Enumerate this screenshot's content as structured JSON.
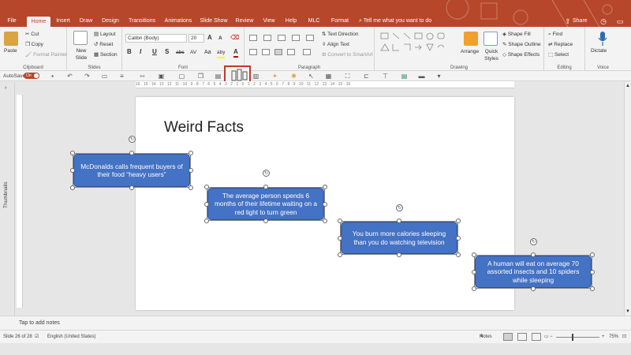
{
  "tabs": [
    "File",
    "Home",
    "Insert",
    "Draw",
    "Design",
    "Transitions",
    "Animations",
    "Slide Show",
    "Review",
    "View",
    "Help",
    "MLC",
    "Format"
  ],
  "tell_me": "Tell me what you want to do",
  "share": "Share",
  "ribbon": {
    "clipboard": {
      "label": "Clipboard",
      "paste": "Paste",
      "cut": "Cut",
      "copy": "Copy",
      "format_painter": "Format Painter"
    },
    "slides": {
      "label": "Slides",
      "new_slide": "New Slide",
      "layout": "Layout",
      "reset": "Reset",
      "section": "Section"
    },
    "font": {
      "label": "Font",
      "name": "Calibri (Body)",
      "size": "20",
      "bold": "B",
      "italic": "I",
      "underline": "U",
      "strike": "S",
      "abc": "abc",
      "spacing": "AV",
      "case": "Aa",
      "grow": "A",
      "shrink": "A",
      "highlight": "aby",
      "color": "A"
    },
    "paragraph": {
      "label": "Paragraph",
      "text_direction": "Text Direction",
      "align_text": "Align Text",
      "smartart": "Convert to SmartArt"
    },
    "drawing": {
      "label": "Drawing",
      "arrange": "Arrange",
      "quick_styles": "Quick Styles",
      "shape_fill": "Shape Fill",
      "shape_outline": "Shape Outline",
      "shape_effects": "Shape Effects"
    },
    "editing": {
      "label": "Editing",
      "find": "Find",
      "replace": "Replace",
      "select": "Select"
    },
    "voice": {
      "label": "Voice",
      "dictate": "Dictate"
    }
  },
  "qat": {
    "autosave": "AutoSave",
    "toggle": "On"
  },
  "ruler_text": "16 · 15 · 14 · 13 · 12 · 11 · 10 · 9 · 8 · 7 · 6 · 5 · 4 · 3 · 2 · 1 · 0 · 1 · 2 · 3 · 4 · 5 · 6 · 7 · 8 · 9 · 10 · 11 · 12 · 13 · 14 · 15 · 16",
  "thumbnails_label": "Thumbnails",
  "slide": {
    "title": "Weird Facts",
    "boxes": [
      "McDonalds calls frequent buyers of their food “heavy users”",
      "The average person spends 6 months of their lifetime waiting on a red light to turn green",
      "You burn more calories sleeping than you do watching television",
      "A human will eat on average 70 assorted insects and 10 spiders while sleeping"
    ]
  },
  "notes_placeholder": "Tap to add notes",
  "status": {
    "slide": "Slide 26 of 28",
    "language": "English (United States)",
    "notes": "Notes",
    "zoom": "75%"
  },
  "colors": {
    "accent": "#b7472a",
    "shape_fill": "#4472c4"
  }
}
